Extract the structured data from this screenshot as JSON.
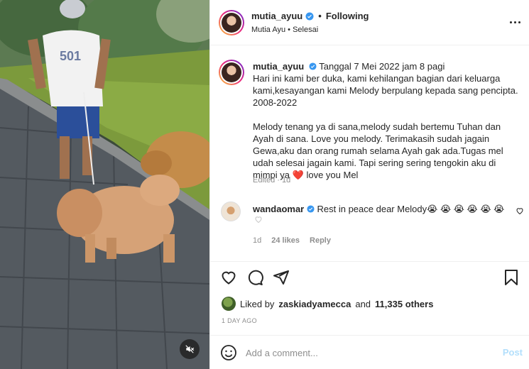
{
  "header": {
    "username": "mutia_ayuu",
    "follow_label": "Following",
    "dot": "•",
    "subtitle": "Mutia Ayu • Selesai"
  },
  "caption": {
    "username": "mutia_ayuu",
    "line1": "Tanggal 7 Mei 2022 jam 8 pagi",
    "line2": "Hari ini kami ber duka, kami kehilangan bagian dari keluarga kami,kesayangan kami Melody berpulang kepada sang pencipta. 2008-2022",
    "para2_pre": "Melody tenang ya di sana,melody sudah bertemu Tuhan dan Ayah di sana. Love you melody. Terimakasih sudah jagain Gewa,aku dan orang rumah selama Ayah gak ada.Tugas mel udah selesai jagain kami. Tapi sering sering tengokin aku di mimpi ya",
    "heart": "❤️",
    "para2_post": "love you Mel",
    "meta": "Edited · 1d"
  },
  "comment": {
    "username": "wandaomar",
    "text": "Rest in peace dear Melody😭 😭 😭 😭 😭 😭",
    "time": "1d",
    "likes": "24 likes",
    "reply_label": "Reply"
  },
  "likes": {
    "prefix": "Liked by",
    "user": "zaskiadyamecca",
    "and": "and",
    "count": "11,335 others"
  },
  "timestamp": "1 DAY AGO",
  "add_comment": {
    "placeholder": "Add a comment...",
    "post_label": "Post"
  },
  "colors": {
    "verified": "#3897f0",
    "link_blue_disabled": "#b2dffc",
    "heart_red": "#ed1c39",
    "muted": "#8e8e8e"
  },
  "icons": [
    "verified-badge-icon",
    "more-icon",
    "heart-outline-icon",
    "comment-icon",
    "share-icon",
    "bookmark-icon",
    "emoji-icon",
    "mute-icon"
  ]
}
